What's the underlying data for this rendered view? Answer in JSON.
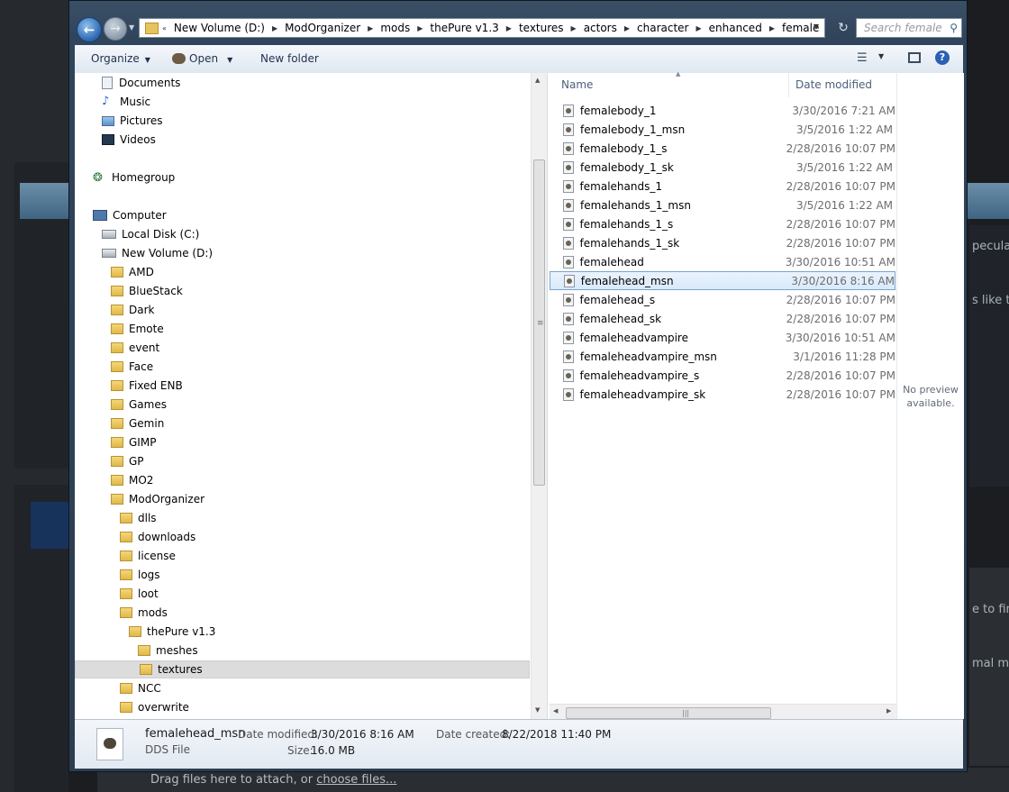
{
  "background": {
    "right_text_1": "pecular",
    "right_text_2": "s like th",
    "right_text_3": "e to find",
    "right_text_4": "mal map",
    "attach_prefix": "Drag files here to attach, or ",
    "attach_link": "choose files..."
  },
  "address_bar": {
    "crumbs": [
      "New Volume (D:)",
      "ModOrganizer",
      "mods",
      "thePure v1.3",
      "textures",
      "actors",
      "character",
      "enhanced",
      "female"
    ],
    "search_placeholder": "Search female"
  },
  "toolbar": {
    "organize": "Organize",
    "open": "Open",
    "new_folder": "New folder"
  },
  "nav_tree": [
    {
      "label": "Documents",
      "icon": "documents-icon"
    },
    {
      "label": "Music",
      "icon": "music-icon"
    },
    {
      "label": "Pictures",
      "icon": "pictures-icon"
    },
    {
      "label": "Videos",
      "icon": "videos-icon"
    },
    {
      "label": "Homegroup",
      "icon": "homegroup-icon"
    },
    {
      "label": "Computer",
      "icon": "computer-icon"
    },
    {
      "label": "Local Disk (C:)",
      "icon": "disk-icon"
    },
    {
      "label": "New Volume (D:)",
      "icon": "disk-icon"
    },
    {
      "label": "AMD",
      "icon": "folder-icon"
    },
    {
      "label": "BlueStack",
      "icon": "folder-icon"
    },
    {
      "label": "Dark",
      "icon": "folder-icon"
    },
    {
      "label": "Emote",
      "icon": "folder-icon"
    },
    {
      "label": "event",
      "icon": "folder-icon"
    },
    {
      "label": "Face",
      "icon": "folder-icon"
    },
    {
      "label": "Fixed ENB",
      "icon": "folder-icon"
    },
    {
      "label": "Games",
      "icon": "folder-icon"
    },
    {
      "label": "Gemin",
      "icon": "folder-icon"
    },
    {
      "label": "GIMP",
      "icon": "folder-icon"
    },
    {
      "label": "GP",
      "icon": "folder-icon"
    },
    {
      "label": "MO2",
      "icon": "folder-icon"
    },
    {
      "label": "ModOrganizer",
      "icon": "folder-icon"
    },
    {
      "label": "dlls",
      "icon": "folder-icon"
    },
    {
      "label": "downloads",
      "icon": "folder-icon"
    },
    {
      "label": "license",
      "icon": "folder-icon"
    },
    {
      "label": "logs",
      "icon": "folder-icon"
    },
    {
      "label": "loot",
      "icon": "folder-icon"
    },
    {
      "label": "mods",
      "icon": "folder-icon"
    },
    {
      "label": "thePure v1.3",
      "icon": "folder-icon"
    },
    {
      "label": "meshes",
      "icon": "folder-icon"
    },
    {
      "label": "textures",
      "icon": "folder-icon",
      "selected": true
    },
    {
      "label": "NCC",
      "icon": "folder-icon"
    },
    {
      "label": "overwrite",
      "icon": "folder-icon"
    }
  ],
  "file_list": {
    "columns": [
      "Name",
      "Date modified"
    ],
    "rows": [
      {
        "name": "femalebody_1",
        "date": "3/30/2016 7:21 AM"
      },
      {
        "name": "femalebody_1_msn",
        "date": "3/5/2016 1:22 AM"
      },
      {
        "name": "femalebody_1_s",
        "date": "2/28/2016 10:07 PM"
      },
      {
        "name": "femalebody_1_sk",
        "date": "3/5/2016 1:22 AM"
      },
      {
        "name": "femalehands_1",
        "date": "2/28/2016 10:07 PM"
      },
      {
        "name": "femalehands_1_msn",
        "date": "3/5/2016 1:22 AM"
      },
      {
        "name": "femalehands_1_s",
        "date": "2/28/2016 10:07 PM"
      },
      {
        "name": "femalehands_1_sk",
        "date": "2/28/2016 10:07 PM"
      },
      {
        "name": "femalehead",
        "date": "3/30/2016 10:51 AM"
      },
      {
        "name": "femalehead_msn",
        "date": "3/30/2016 8:16 AM",
        "selected": true
      },
      {
        "name": "femalehead_s",
        "date": "2/28/2016 10:07 PM"
      },
      {
        "name": "femalehead_sk",
        "date": "2/28/2016 10:07 PM"
      },
      {
        "name": "femaleheadvampire",
        "date": "3/30/2016 10:51 AM"
      },
      {
        "name": "femaleheadvampire_msn",
        "date": "3/1/2016 11:28 PM"
      },
      {
        "name": "femaleheadvampire_s",
        "date": "2/28/2016 10:07 PM"
      },
      {
        "name": "femaleheadvampire_sk",
        "date": "2/28/2016 10:07 PM"
      }
    ]
  },
  "preview": {
    "line1": "No preview",
    "line2": "available."
  },
  "details": {
    "name": "femalehead_msn",
    "type": "DDS File",
    "modified_label": "Date modified:",
    "modified_value": "3/30/2016 8:16 AM",
    "created_label": "Date created:",
    "created_value": "8/22/2018 11:40 PM",
    "size_label": "Size:",
    "size_value": "16.0 MB"
  }
}
